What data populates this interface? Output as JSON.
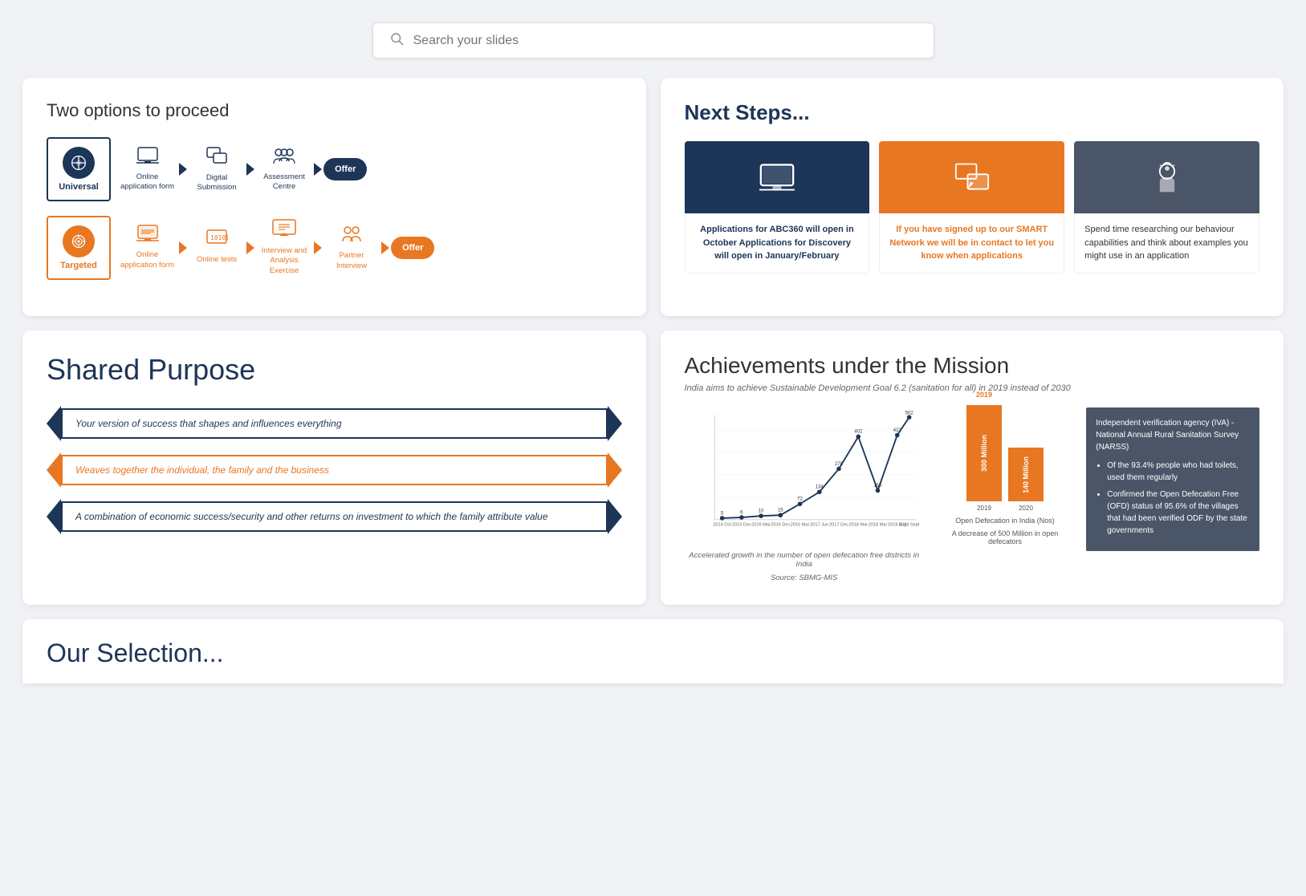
{
  "search": {
    "placeholder": "Search your slides"
  },
  "slide1": {
    "title": "Two options to proceed",
    "universal": {
      "label": "Universal"
    },
    "targeted": {
      "label": "Targeted"
    },
    "universal_steps": [
      "Online application form",
      "Digital Submission",
      "Assessment Centre",
      "Offer"
    ],
    "targeted_steps": [
      "Online application form",
      "Online tests",
      "Interview and Analysis Exercise",
      "Partner Interview",
      "Offer"
    ]
  },
  "slide2": {
    "title": "Next Steps...",
    "cards": [
      {
        "body": "Applications for ABC360 will open in October Applications for Discovery will open in January/February",
        "type": "blue"
      },
      {
        "body": "If you have signed up to our SMART Network we will be in contact to let you know when applications",
        "type": "orange"
      },
      {
        "body": "Spend time researching our behaviour capabilities and think about examples you might use in an application",
        "type": "dark"
      }
    ]
  },
  "slide3": {
    "title": "Shared Purpose",
    "items": [
      "Your version of success that shapes and influences everything",
      "Weaves together the individual, the family and the business",
      "A combination of economic success/security and other returns on investment to which the family attribute value"
    ]
  },
  "slide4": {
    "title": "Achievements under the Mission",
    "subtitle": "India aims to achieve Sustainable Development Goal 6.2 (sanitation for all) in 2019 instead of 2030",
    "chart_caption": "Accelerated growth in the number of open defecation free districts in India",
    "chart_source": "Source: SBMG-MIS",
    "bar_chart_caption": "Open Defecation in India (Nos)",
    "bar_chart_note": "A decrease of 500 Million in open defecators",
    "bar1_label": "2019",
    "bar1_value": "300 Million",
    "bar2_label": "2020",
    "bar2_value": "140 Million",
    "info_title": "Independent verification agency (IVA) - National Annual Rural Sanitation Survey (NARSS)",
    "info_bullets": [
      "Of the 93.4% people who had toilets, used them regularly",
      "Confirmed the Open Defecation Free (OFD) status of 95.6% of the villages that had been verified ODF by the state governments"
    ],
    "line_points": [
      {
        "year": "2014 Oct",
        "val": 5
      },
      {
        "year": "2015 Dec",
        "val": 6
      },
      {
        "year": "2016 Mar",
        "val": 10
      },
      {
        "year": "2016 Dec",
        "val": 15
      },
      {
        "year": "2016 Mar",
        "val": 72
      },
      {
        "year": "2017 Jun",
        "val": 134
      },
      {
        "year": "2017 Dec",
        "val": 270
      },
      {
        "year": "2018 Mar",
        "val": 402
      },
      {
        "year": "2018 Mar",
        "val": 150
      },
      {
        "year": "2018 Aug",
        "val": 422
      },
      {
        "year": "2018 Sept",
        "val": 502
      }
    ]
  },
  "partial": {
    "title": "Our Selection..."
  }
}
